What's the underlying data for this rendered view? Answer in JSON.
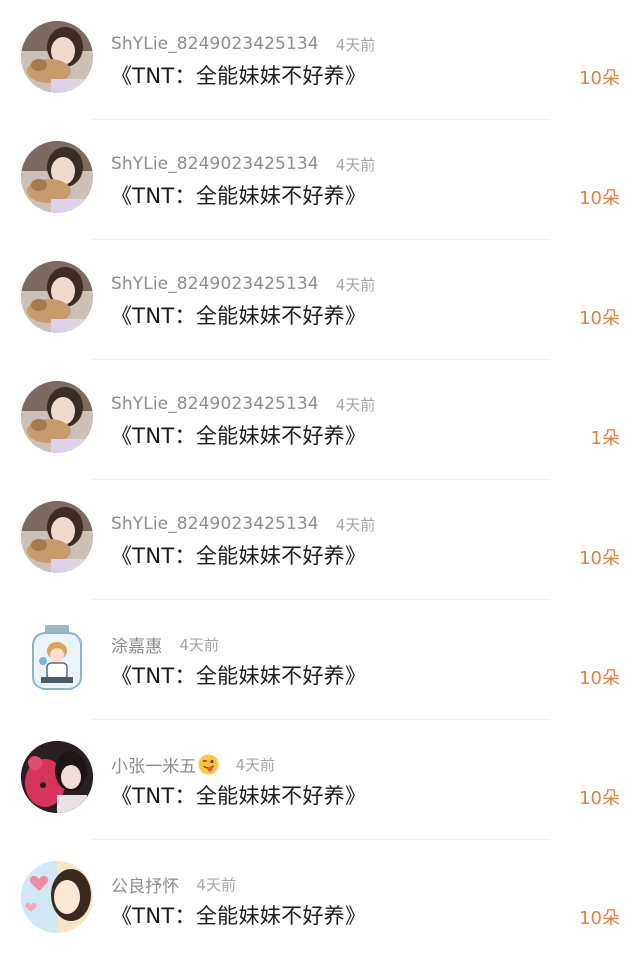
{
  "records": [
    {
      "username": "ShYLie_8249023425134",
      "time": "4天前",
      "content": "《TNT：全能妹妹不好养》",
      "amount": "10朵",
      "avatar_icon": "girl-with-dog-avatar-icon",
      "emoji": ""
    },
    {
      "username": "ShYLie_8249023425134",
      "time": "4天前",
      "content": "《TNT：全能妹妹不好养》",
      "amount": "10朵",
      "avatar_icon": "girl-with-dog-avatar-icon",
      "emoji": ""
    },
    {
      "username": "ShYLie_8249023425134",
      "time": "4天前",
      "content": "《TNT：全能妹妹不好养》",
      "amount": "10朵",
      "avatar_icon": "girl-with-dog-avatar-icon",
      "emoji": ""
    },
    {
      "username": "ShYLie_8249023425134",
      "time": "4天前",
      "content": "《TNT：全能妹妹不好养》",
      "amount": "1朵",
      "avatar_icon": "girl-with-dog-avatar-icon",
      "emoji": ""
    },
    {
      "username": "ShYLie_8249023425134",
      "time": "4天前",
      "content": "《TNT：全能妹妹不好养》",
      "amount": "10朵",
      "avatar_icon": "girl-with-dog-avatar-icon",
      "emoji": ""
    },
    {
      "username": "涂嘉惠",
      "time": "4天前",
      "content": "《TNT：全能妹妹不好养》",
      "amount": "10朵",
      "avatar_icon": "anime-boy-in-jar-avatar-icon",
      "emoji": ""
    },
    {
      "username": "小张一米五",
      "time": "4天前",
      "content": "《TNT：全能妹妹不好养》",
      "amount": "10朵",
      "avatar_icon": "girl-with-pink-bear-avatar-icon",
      "emoji": "tongue-wink-emoji-icon"
    },
    {
      "username": "公良抒怀",
      "time": "4天前",
      "content": "《TNT：全能妹妹不好养》",
      "amount": "10朵",
      "avatar_icon": "cartoon-girl-heart-avatar-icon",
      "emoji": ""
    }
  ],
  "colors": {
    "username": "#8c8c8c",
    "time": "#a6a6a6",
    "content": "#1a1a1a",
    "amount": "#e57f3a",
    "divider": "#f1f1f1"
  }
}
